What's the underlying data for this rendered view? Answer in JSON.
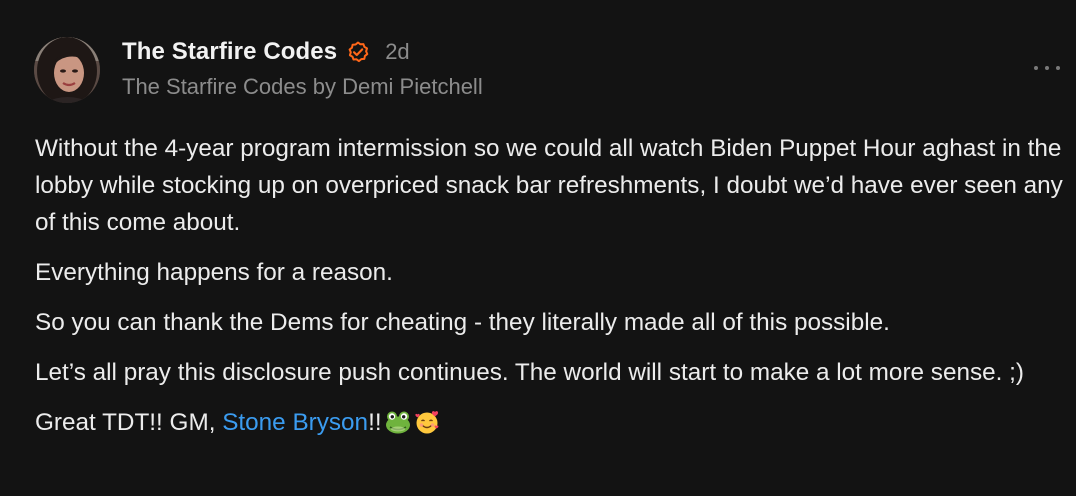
{
  "post": {
    "author_name": "The Starfire Codes",
    "timestamp": "2d",
    "publication": "The Starfire Codes by Demi Pietchell",
    "avatar_icon": "author-avatar",
    "verified_icon": "verified-badge-icon",
    "more_icon": "more-options-icon",
    "paragraphs": [
      "Without the 4-year program intermission so we could all watch Biden Puppet Hour aghast in the lobby while stocking up on overpriced snack bar refreshments, I doubt we’d have ever seen any of this come about.",
      "Everything happens for a reason.",
      "So you can thank the Dems for cheating - they literally made all of this possible.",
      "Let’s all pray this disclosure push continues. The world will start to make a lot more sense. ;)"
    ],
    "last_line": {
      "prefix": "Great TDT!! GM, ",
      "mention": "Stone Bryson",
      "suffix": "!!",
      "emojis": [
        "frog-emoji",
        "smiling-face-with-hearts-emoji"
      ]
    }
  },
  "colors": {
    "background": "#131313",
    "text": "#ececec",
    "muted": "#8c8c8c",
    "accent": "#ff6719",
    "mention": "#3b9cf0"
  }
}
